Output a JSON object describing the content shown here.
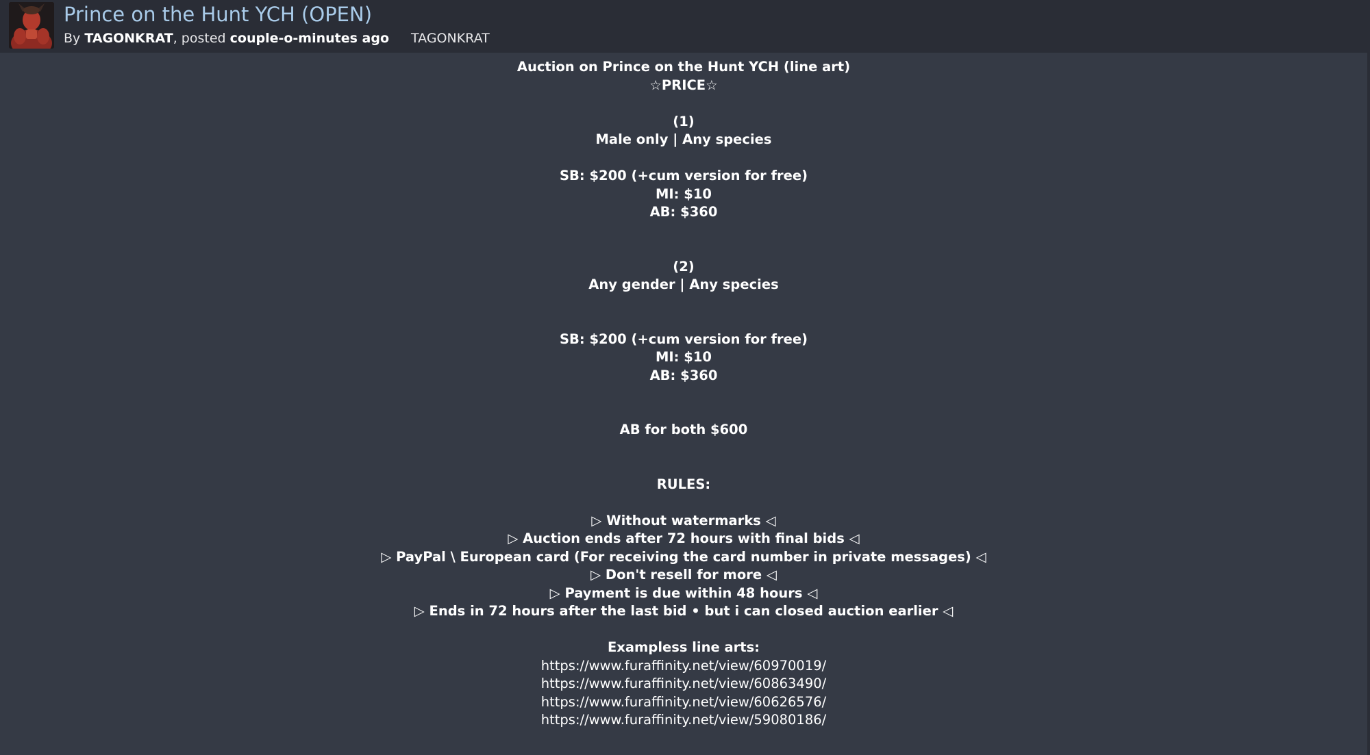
{
  "header": {
    "title": "Prince on the Hunt YCH (OPEN)",
    "by_prefix": "By ",
    "author": "TAGONKRAT",
    "posted_text": ", posted ",
    "posted_time": "couple-o-minutes ago",
    "tag": "TAGONKRAT"
  },
  "description": {
    "heading": "Auction on Prince on the Hunt YCH (line art)",
    "price_heading": "☆PRICE☆",
    "option1": {
      "label": "(1)",
      "restriction": "Male only | Any species",
      "sb": "SB: $200 (+cum version for free)",
      "mi": "MI: $10",
      "ab": "AB: $360"
    },
    "option2": {
      "label": "(2)",
      "restriction": "Any gender | Any species",
      "sb": "SB: $200 (+cum version for free)",
      "mi": "MI: $10",
      "ab": "AB: $360"
    },
    "ab_both": "AB for both $600",
    "rules_heading": "RULES:",
    "rules": [
      "▷ Without watermarks ◁",
      "▷ Auction ends after 72 hours with final bids ◁",
      "▷ PayPal \\ European card (For receiving the card number in private messages) ◁",
      "▷ Don't resell for more ◁",
      "▷ Payment is due within 48 hours ◁",
      "▷ Ends in 72 hours after the last bid • but i can closed auction earlier ◁"
    ],
    "examples_heading": "Exampless line arts:",
    "example_links": [
      "https://www.furaffinity.net/view/60970019/",
      "https://www.furaffinity.net/view/60863490/",
      "https://www.furaffinity.net/view/60626576/",
      "https://www.furaffinity.net/view/59080186/"
    ]
  }
}
